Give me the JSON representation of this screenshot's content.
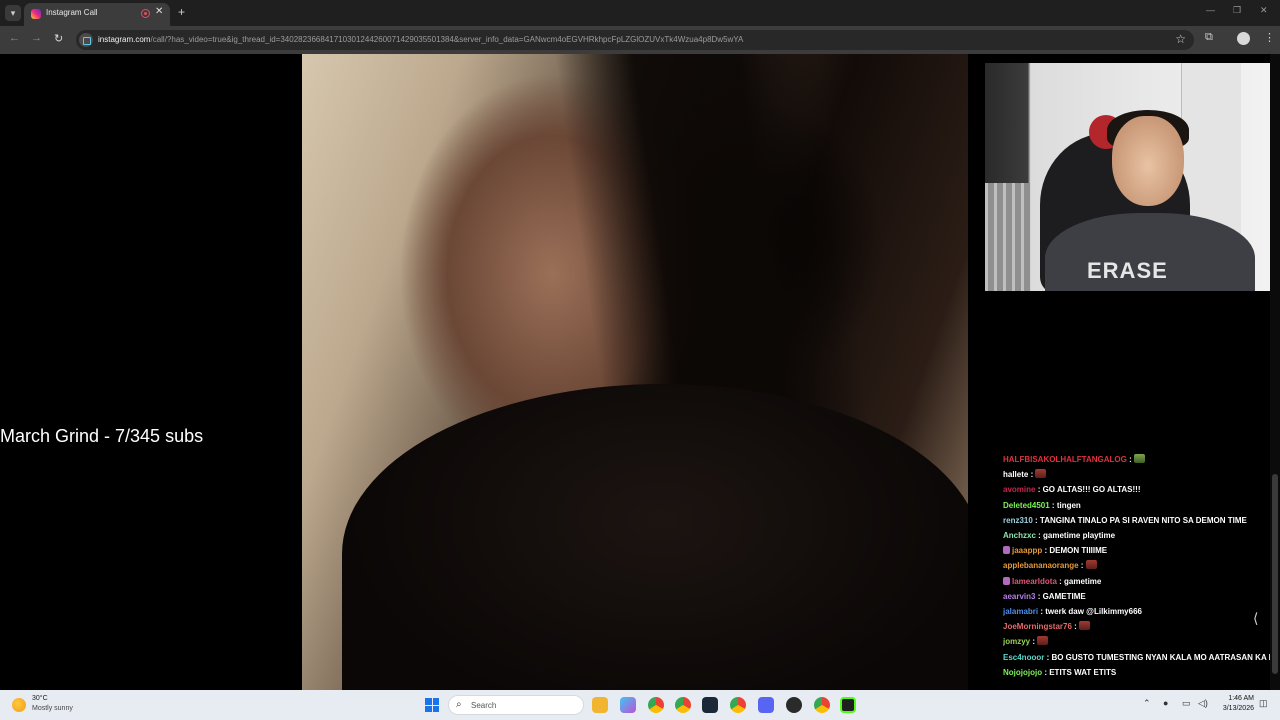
{
  "browser": {
    "tab_title": "Instagram Call",
    "url_host": "instagram.com",
    "url_path": "/call/?has_video=true&ig_thread_id=340282366841710301244260071429035501384&server_info_data=GANwcm4oEGVHRkhpcFpLZGlOZUVxTk4Wzua4p8Dw5wYA"
  },
  "icons": {
    "tab_menu": "chevron-down-icon",
    "new_tab": "plus-icon",
    "back": "arrow-left-icon",
    "forward": "arrow-right-icon",
    "reload": "reload-icon",
    "bookmark": "star-icon",
    "extensions": "puzzle-icon",
    "more": "more-vert-icon"
  },
  "overlay": {
    "grind_text": "March Grind - 7/345 subs",
    "webcam_shirt_text": "ERASE"
  },
  "chat": {
    "messages": [
      {
        "user": "HALFBISAKOLHALFTANGALOG",
        "color": "#e0323c",
        "text": "",
        "emote": "green"
      },
      {
        "user": "hallete",
        "color": "#ffffff",
        "text": "",
        "emote": "red"
      },
      {
        "user": "avomine",
        "color": "#c7274b",
        "text": "GO ALTAS!!! GO ALTAS!!!"
      },
      {
        "user": "Deleted4501",
        "color": "#7ef05a",
        "text": "tingen"
      },
      {
        "user": "renz310",
        "color": "#9bd1e0",
        "text": "TANGINA TINALO PA SI RAVEN NITO SA DEMON TIME"
      },
      {
        "user": "Anchzxc",
        "color": "#8fe3b0",
        "text": "gametime playtime"
      },
      {
        "user": "jaaappp",
        "color": "#e39a3c",
        "text": "DEMON TIIIIME",
        "badge": true
      },
      {
        "user": "applebananaorange",
        "color": "#e39a3c",
        "text": "",
        "emote": "red"
      },
      {
        "user": "lamearldota",
        "color": "#e0567a",
        "text": "gametime",
        "badge": true
      },
      {
        "user": "aearvin3",
        "color": "#b57ee8",
        "text": "GAMETIME"
      },
      {
        "user": "jalamabri",
        "color": "#4f8fe8",
        "text": "twerk daw @Lilkimmy666"
      },
      {
        "user": "JoeMorningstar76",
        "color": "#e56a6a",
        "text": "",
        "emote": "red"
      },
      {
        "user": "jomzyy",
        "color": "#9cd05a",
        "text": "",
        "emote": "red"
      },
      {
        "user": "Esc4nooor",
        "color": "#5ad6c8",
        "text": "BO GUSTO TUMESTING NYAN KALA MO AATRASAN KA NAMI"
      },
      {
        "user": "Nojojojojo",
        "color": "#7ef05a",
        "text": "ETITS WAT ETITS"
      }
    ]
  },
  "taskbar": {
    "weather_temp": "30°C",
    "weather_desc": "Mostly sunny",
    "search_placeholder": "Search",
    "clock_time": "1:46 AM",
    "clock_date": "3/13/2026"
  }
}
